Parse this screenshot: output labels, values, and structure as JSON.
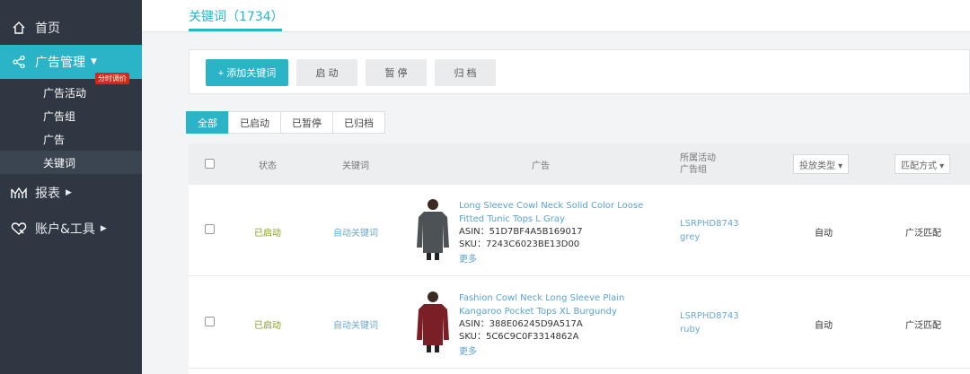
{
  "sidebar": {
    "items": [
      {
        "label": "首页",
        "icon": "home-icon"
      },
      {
        "label": "广告管理",
        "icon": "share-icon"
      },
      {
        "label": "报表",
        "icon": "bar-chart-icon"
      },
      {
        "label": "账户&工具",
        "icon": "heart-tool-icon"
      }
    ],
    "sub_items": [
      "广告活动",
      "广告组",
      "广告",
      "关键词"
    ],
    "badge": "分时调价"
  },
  "header": {
    "tab_title": "关键词（1734）"
  },
  "toolbar": {
    "add_label": "+ 添加关键词",
    "start_label": "启 动",
    "pause_label": "暂 停",
    "archive_label": "归 档"
  },
  "filters": [
    "全部",
    "已启动",
    "已暂停",
    "已归档"
  ],
  "table": {
    "headers": {
      "status": "状态",
      "keyword": "关键词",
      "ad": "广告",
      "campaign_line1": "所属活动",
      "campaign_line2": "广告组",
      "delivery_type": "投放类型 ▾",
      "match_type": "匹配方式 ▾"
    },
    "rows": [
      {
        "status": "已启动",
        "keyword": "自动关键词",
        "title_line1": "Long Sleeve Cowl Neck Solid Color Loose",
        "title_line2": "Fitted Tunic Tops L Gray",
        "asin": "ASIN：51D7BF4A5B169017",
        "sku": "SKU：7243C6023BE13D00",
        "more": "更多",
        "campaign": "LSRPHD8743",
        "adgroup": "grey",
        "delivery": "自动",
        "match": "广泛匹配",
        "color": "#4d5257"
      },
      {
        "status": "已启动",
        "keyword": "自动关键词",
        "title_line1": "Fashion Cowl Neck Long Sleeve Plain",
        "title_line2": "Kangaroo Pocket Tops XL Burgundy",
        "asin": "ASIN：388E06245D9A517A",
        "sku": "SKU：5C6C9C0F3314862A",
        "more": "更多",
        "campaign": "LSRPHD8743",
        "adgroup": "ruby",
        "delivery": "自动",
        "match": "广泛匹配",
        "color": "#7a1f25"
      }
    ]
  }
}
